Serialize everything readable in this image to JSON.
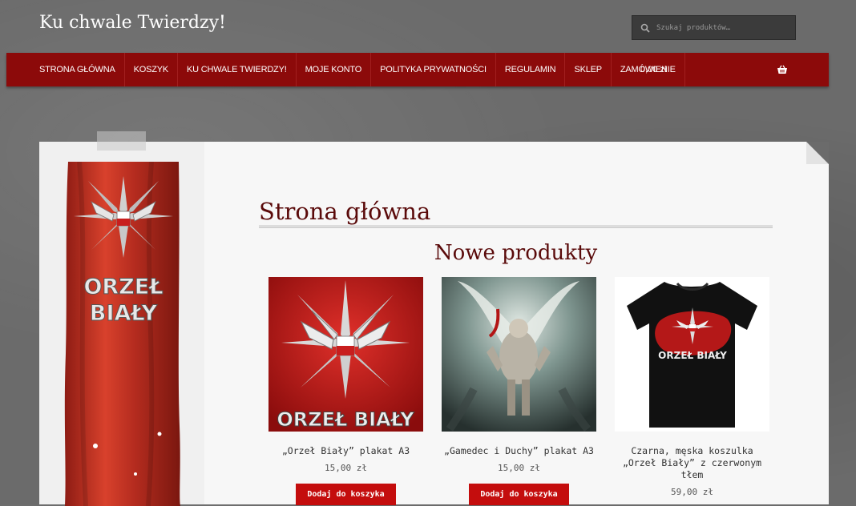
{
  "site": {
    "title": "Ku chwale Twierdzy!"
  },
  "search": {
    "placeholder": "Szukaj produktów…",
    "icon": "search-icon"
  },
  "nav": {
    "items": [
      {
        "label": "Strona główna"
      },
      {
        "label": "Koszyk"
      },
      {
        "label": "Ku chwale Twierdzy!"
      },
      {
        "label": "Moje konto"
      },
      {
        "label": "Polityka prywatności"
      },
      {
        "label": "Regulamin"
      },
      {
        "label": "Sklep"
      },
      {
        "label": "Zamówienie"
      }
    ],
    "cart_total": "0,00 zł",
    "cart_icon": "basket-icon",
    "bar_color": "#8c0a0a"
  },
  "sidebar": {
    "banner_text_line1": "ORZEŁ",
    "banner_text_line2": "BIAŁY"
  },
  "page": {
    "title": "Strona główna",
    "section_title": "Nowe produkty"
  },
  "products": [
    {
      "name": "„Orzeł Biały” plakat A3",
      "price": "15,00 zł",
      "button": "Dodaj do koszyka",
      "image_text": "ORZEŁ BIAŁY"
    },
    {
      "name": "„Gamedec i Duchy” plakat A3",
      "price": "15,00 zł",
      "button": "Dodaj do koszyka"
    },
    {
      "name": "Czarna, męska koszulka „Orzeł Biały” z czerwonym tłem",
      "price": "59,00 zł",
      "button": "Dodaj do koszyka",
      "image_text": "ORZEŁ BIAŁY"
    }
  ],
  "colors": {
    "accent": "#c40d0d",
    "title": "#5a0a0a"
  }
}
